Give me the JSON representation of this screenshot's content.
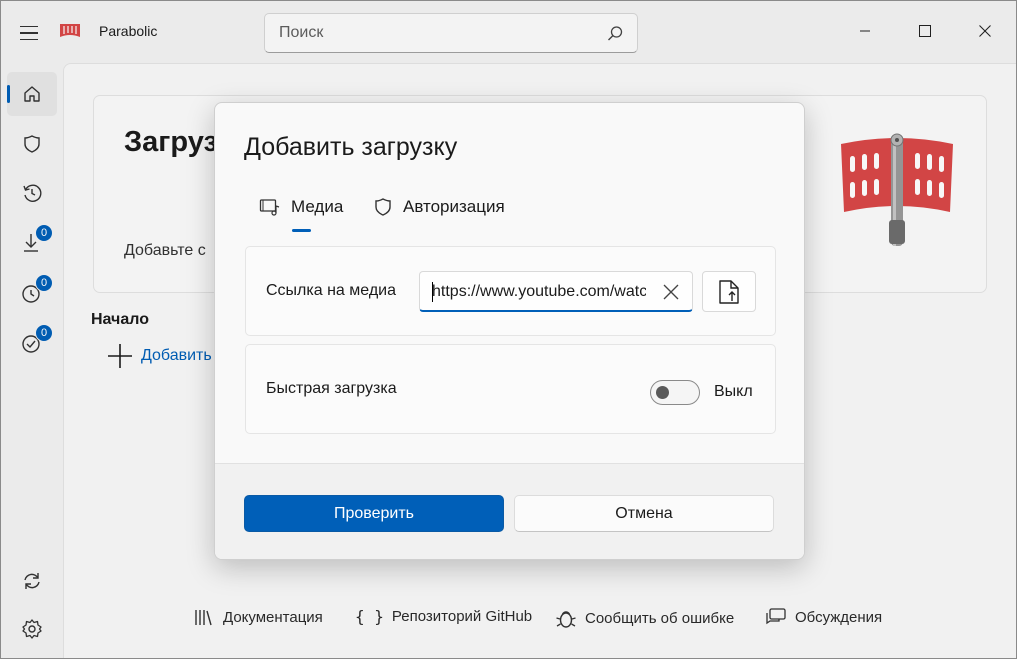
{
  "app": {
    "title": "Parabolic"
  },
  "search": {
    "placeholder": "Поиск"
  },
  "sidebar": {
    "items": [
      {
        "name": "home",
        "active": true
      },
      {
        "name": "shield"
      },
      {
        "name": "history"
      },
      {
        "name": "downloading",
        "badge": "0"
      },
      {
        "name": "queued",
        "badge": "0"
      },
      {
        "name": "completed",
        "badge": "0"
      },
      {
        "name": "updates"
      },
      {
        "name": "settings"
      }
    ]
  },
  "home": {
    "hero_title": "Загрузки",
    "hero_subtitle": "Добавьте с",
    "start_heading": "Начало",
    "add_link": "Добавить"
  },
  "footer": {
    "documentation": "Документация",
    "github": "Репозиторий GitHub",
    "report": "Сообщить об ошибке",
    "discussions": "Обсуждения"
  },
  "dialog": {
    "title": "Добавить загрузку",
    "tabs": {
      "media": "Медиа",
      "auth": "Авторизация"
    },
    "media_url_label": "Ссылка на медиа",
    "media_url_value": "https://www.youtube.com/watch",
    "quick_download_label": "Быстрая загрузка",
    "quick_download_state": "Выкл",
    "quick_download_on": false,
    "validate_button": "Проверить",
    "cancel_button": "Отмена"
  },
  "colors": {
    "accent": "#005fb8",
    "logo_red": "#d94848"
  }
}
